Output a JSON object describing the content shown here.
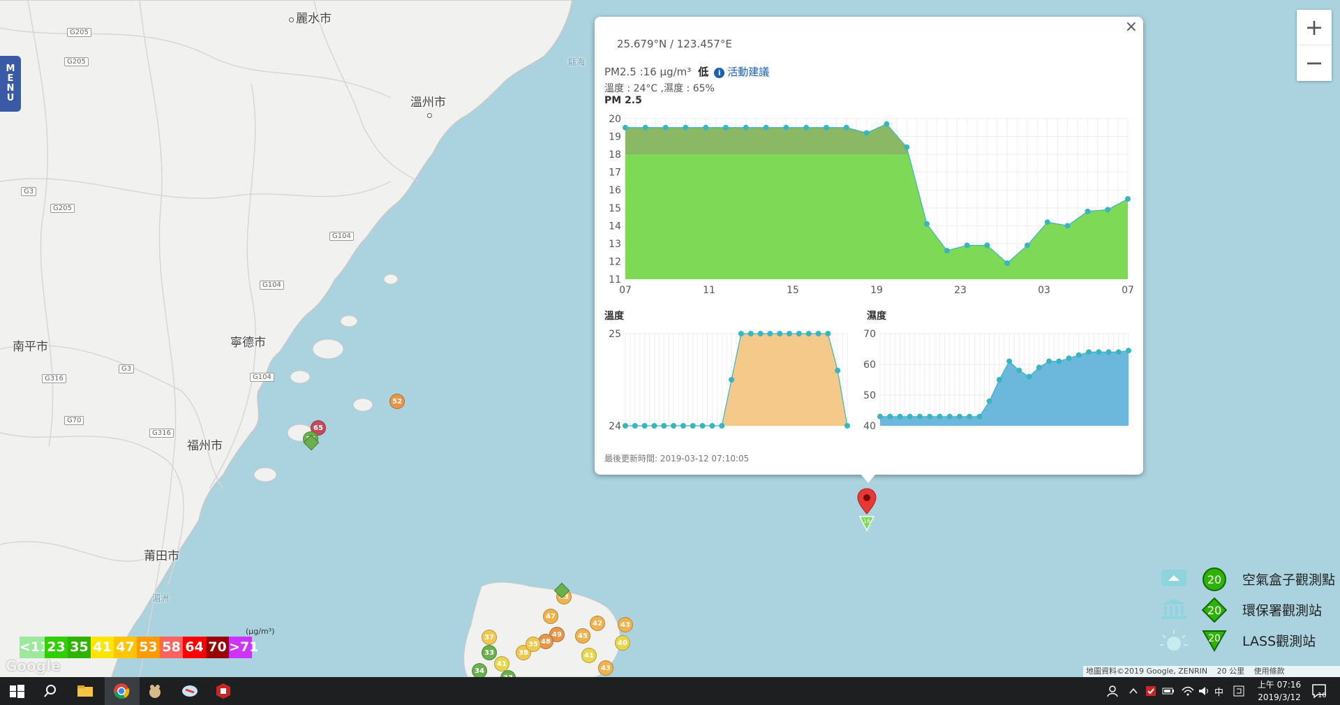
{
  "map": {
    "cities": [
      {
        "name": "麗水市"
      },
      {
        "name": "溫州市"
      },
      {
        "name": "南平市"
      },
      {
        "name": "寧德市"
      },
      {
        "name": "福州市"
      },
      {
        "name": "莆田市"
      }
    ],
    "water_labels": [
      "甌海",
      "湄洲"
    ],
    "menu_label": [
      "M",
      "E",
      "N",
      "U"
    ],
    "zoom_in": "+",
    "zoom_out": "−",
    "highways": [
      "G205",
      "G205",
      "G3",
      "G205",
      "G104",
      "G104",
      "G3",
      "G104",
      "G316",
      "G70",
      "G316"
    ],
    "markers": [
      {
        "value": "52",
        "color": "#e8944a"
      },
      {
        "value": "65",
        "color": "#c24b5a"
      },
      {
        "value": "34",
        "color": "#6ab04c"
      },
      {
        "value": "43",
        "color": "#f0b24c"
      },
      {
        "value": "42",
        "color": "#f0b24c"
      },
      {
        "value": "43",
        "color": "#f0b24c"
      },
      {
        "value": "49",
        "color": "#e8944a"
      },
      {
        "value": "45",
        "color": "#f0b24c"
      },
      {
        "value": "47",
        "color": "#f0b24c"
      },
      {
        "value": "48",
        "color": "#e8944a"
      },
      {
        "value": "37",
        "color": "#f0c850"
      },
      {
        "value": "33",
        "color": "#6ab04c"
      },
      {
        "value": "41",
        "color": "#e9d64c"
      },
      {
        "value": "38",
        "color": "#f0c850"
      },
      {
        "value": "35",
        "color": "#f0c850"
      },
      {
        "value": "41",
        "color": "#e9d64c"
      },
      {
        "value": "33",
        "color": "#6ab04c"
      },
      {
        "value": "34",
        "color": "#6ab04c"
      },
      {
        "value": "43",
        "color": "#f0b24c"
      },
      {
        "value": "40",
        "color": "#e9d64c"
      }
    ],
    "selected_pin_value": "16"
  },
  "popup": {
    "close_label": "×",
    "coordinates": "25.679°N / 123.457°E",
    "pm_text": "PM2.5 :16 μg/m³",
    "pm_level": "低",
    "info_icon": "i",
    "advice_link": "活動建議",
    "temp_humidity": "溫度 : 24°C ,濕度 : 65%",
    "pm_chart_title": "PM 2.5",
    "temp_chart_title": "溫度",
    "humidity_chart_title": "濕度",
    "updated": "最後更新時間: 2019-03-12 07:10:05"
  },
  "chart_data": [
    {
      "type": "area",
      "title": "PM 2.5",
      "ylim": [
        11,
        20
      ],
      "yticks": [
        "20",
        "19",
        "18",
        "17",
        "16",
        "15",
        "14",
        "13",
        "12",
        "11"
      ],
      "xticks": [
        "07",
        "11",
        "15",
        "19",
        "23",
        "03",
        "07"
      ],
      "values": [
        19.5,
        19.5,
        19.5,
        19.5,
        19.5,
        19.5,
        19.5,
        19.5,
        19.5,
        19.5,
        19.5,
        19.5,
        19.2,
        19.7,
        18.4,
        14.1,
        12.6,
        12.9,
        12.9,
        11.9,
        12.9,
        14.2,
        14.0,
        14.8,
        14.9,
        15.5
      ],
      "fill_color": "#7ed957",
      "fill_dark_color": "#8bb864",
      "point_color": "#3bb4c1"
    },
    {
      "type": "area",
      "title": "溫度",
      "ylim": [
        24,
        25
      ],
      "yticks": [
        "25",
        "24"
      ],
      "values": [
        24,
        24,
        24,
        24,
        24,
        24,
        24,
        24,
        24,
        24,
        24,
        24.5,
        25,
        25,
        25,
        25,
        25,
        25,
        25,
        25,
        25,
        25,
        24.6,
        24
      ],
      "fill_color": "#f4c98a",
      "point_color": "#3bb4c1"
    },
    {
      "type": "area",
      "title": "濕度",
      "ylim": [
        40,
        70
      ],
      "yticks": [
        "70",
        "60",
        "50",
        "40"
      ],
      "values": [
        43,
        43,
        43,
        43,
        43,
        43,
        43,
        43,
        43,
        43,
        43,
        48,
        55,
        61,
        58,
        56,
        59,
        61,
        61,
        62,
        63,
        64,
        64,
        64,
        64,
        64.5
      ],
      "fill_color": "#6cb8dd",
      "point_color": "#3bb4c1"
    }
  ],
  "aqi_scale": {
    "unit": "(μg/m³)",
    "items": [
      {
        "label": "<11",
        "color": "#9ce89c"
      },
      {
        "label": "23",
        "color": "#31cf00"
      },
      {
        "label": "35",
        "color": "#2fb300"
      },
      {
        "label": "41",
        "color": "#ffe600"
      },
      {
        "label": "47",
        "color": "#fec400"
      },
      {
        "label": "53",
        "color": "#ff9a00"
      },
      {
        "label": "58",
        "color": "#ff6361"
      },
      {
        "label": "64",
        "color": "#ff0000"
      },
      {
        "label": "70",
        "color": "#990000"
      },
      {
        "label": ">71",
        "color": "#cc33ff"
      }
    ]
  },
  "legend": {
    "items": [
      {
        "label": "空氣盒子觀測點",
        "marker": "20"
      },
      {
        "label": "環保署觀測站",
        "marker": "20"
      },
      {
        "label": "LASS觀測站",
        "marker": "20"
      }
    ]
  },
  "attribution": {
    "data": "地圖資料©2019 Google, ZENRIN",
    "scale": "20 公里",
    "terms": "使用條款",
    "google": "Google"
  },
  "taskbar": {
    "ime": "中",
    "time": "上午 07:16",
    "date": "2019/3/12",
    "notification_count": "10",
    "apps": [
      "start-icon",
      "search-icon",
      "file-explorer-icon",
      "chrome-icon",
      "app-icon",
      "app-icon",
      "app-icon"
    ]
  }
}
